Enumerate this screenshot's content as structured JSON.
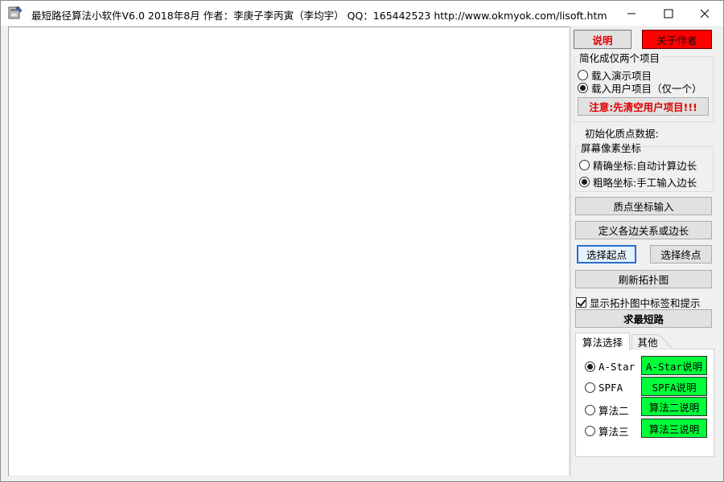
{
  "window": {
    "title": "最短路径算法小软件V6.0  2018年8月 作者：李庚子李丙寅（李均宇）  QQ：165442523  http://www.okmyok.com/lisoft.htm",
    "controls": {
      "minimize": "—",
      "maximize": "☐",
      "close": "✕"
    }
  },
  "panel": {
    "help_button": "说明",
    "about_button": "关于作者",
    "simplify_group": {
      "title": "简化成仅两个项目",
      "options": [
        "载入演示项目",
        "载入用户项目（仅一个）"
      ],
      "selected": 1,
      "warning_button": "注意:先清空用户项目!!!"
    },
    "init_label": "初始化质点数据:",
    "coord_group": {
      "title": "屏幕像素坐标",
      "options": [
        "精确坐标:自动计算边长",
        "粗略坐标:手工输入边长"
      ],
      "selected": 1
    },
    "coord_input_button": "质点坐标输入",
    "define_edges_button": "定义各边关系或边长",
    "select_start_button": "选择起点",
    "select_end_button": "选择终点",
    "refresh_button": "刷新拓扑图",
    "show_labels_checkbox": {
      "label": "显示拓扑图中标签和提示",
      "checked": true
    },
    "solve_button": "求最短路",
    "tabs": [
      "算法选择",
      "其他"
    ],
    "active_tab": 0,
    "algorithms": [
      {
        "name": "A-Star",
        "help": "A-Star说明",
        "selected": true
      },
      {
        "name": "SPFA",
        "help": "SPFA说明",
        "selected": false
      },
      {
        "name": "算法二",
        "help": "算法二说明",
        "selected": false
      },
      {
        "name": "算法三",
        "help": "算法三说明",
        "selected": false
      }
    ]
  }
}
